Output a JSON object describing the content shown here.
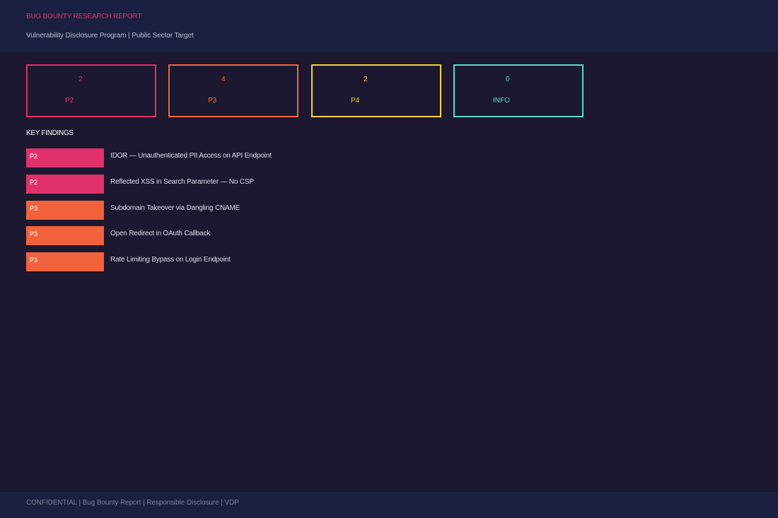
{
  "header": {
    "title": "BUG BOUNTY RESEARCH REPORT",
    "subtitle": "Vulnerability Disclosure Program | Public Sector Target",
    "title_color": "#e0316a"
  },
  "stats": [
    {
      "count": "2",
      "level": "P2",
      "color": "#e0316a"
    },
    {
      "count": "4",
      "level": "P3",
      "color": "#f26640"
    },
    {
      "count": "2",
      "level": "P4",
      "color": "#f7d33a"
    },
    {
      "count": "0",
      "level": "INFO",
      "color": "#5ed8c4"
    }
  ],
  "section": {
    "title": "KEY FINDINGS"
  },
  "findings": [
    {
      "priority": "P2",
      "title": "IDOR — Unauthenticated PII Access on API Endpoint",
      "color": "#e0316a"
    },
    {
      "priority": "P2",
      "title": "Reflected XSS in Search Parameter — No CSP",
      "color": "#e0316a"
    },
    {
      "priority": "P3",
      "title": "Subdomain Takeover via Dangling CNAME",
      "color": "#f2623c"
    },
    {
      "priority": "P3",
      "title": "Open Redirect in OAuth Callback",
      "color": "#f2623c"
    },
    {
      "priority": "P3",
      "title": "Rate Limiting Bypass on Login Endpoint",
      "color": "#f2623c"
    }
  ],
  "footer": {
    "text": "CONFIDENTIAL | Bug Bounty Report | Responsible Disclosure | VDP"
  }
}
